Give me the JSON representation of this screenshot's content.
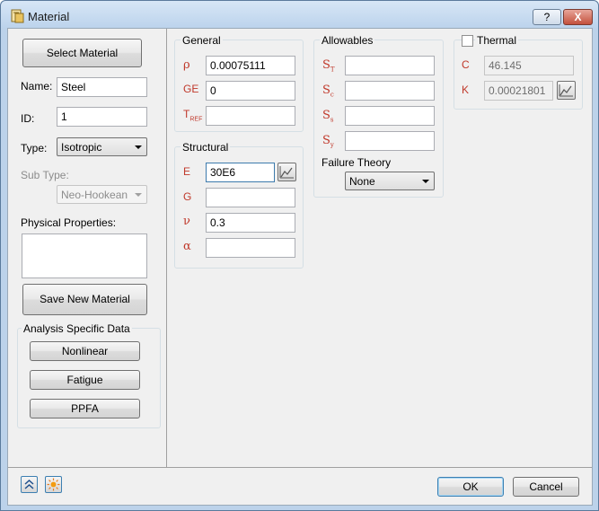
{
  "window": {
    "title": "Material",
    "help": "?",
    "close": "X"
  },
  "left": {
    "select_material": "Select Material",
    "name_label": "Name:",
    "name_value": "Steel",
    "id_label": "ID:",
    "id_value": "1",
    "type_label": "Type:",
    "type_value": "Isotropic",
    "subtype_label": "Sub Type:",
    "subtype_value": "Neo-Hookean",
    "physical_label": "Physical Properties:",
    "save_button": "Save New Material",
    "analysis_title": "Analysis Specific Data",
    "nonlinear": "Nonlinear",
    "fatigue": "Fatigue",
    "ppfa": "PPFA"
  },
  "general": {
    "title": "General",
    "rho_sym": "ρ",
    "rho_value": "0.00075111",
    "ge_sym": "GE",
    "ge_value": "0",
    "tref_sym": "T",
    "tref_sub": "REF",
    "tref_value": ""
  },
  "structural": {
    "title": "Structural",
    "e_sym": "E",
    "e_value": "30E6",
    "g_sym": "G",
    "g_value": "",
    "nu_sym": "ν",
    "nu_value": "0.3",
    "alpha_sym": "α",
    "alpha_value": ""
  },
  "allowables": {
    "title": "Allowables",
    "st_sym": "S",
    "st_sub": "T",
    "st_value": "",
    "sc_sym": "S",
    "sc_sub": "c",
    "sc_value": "",
    "ss_sym": "S",
    "ss_sub": "s",
    "ss_value": "",
    "sy_sym": "S",
    "sy_sub": "y",
    "sy_value": "",
    "failure_label": "Failure Theory",
    "failure_value": "None"
  },
  "thermal": {
    "title": "Thermal",
    "checked": false,
    "c_sym": "C",
    "c_value": "46.145",
    "k_sym": "K",
    "k_value": "0.00021801"
  },
  "footer": {
    "ok": "OK",
    "cancel": "Cancel"
  },
  "colors": {
    "symbol": "#c0392b",
    "accent": "#3c7fb1"
  }
}
